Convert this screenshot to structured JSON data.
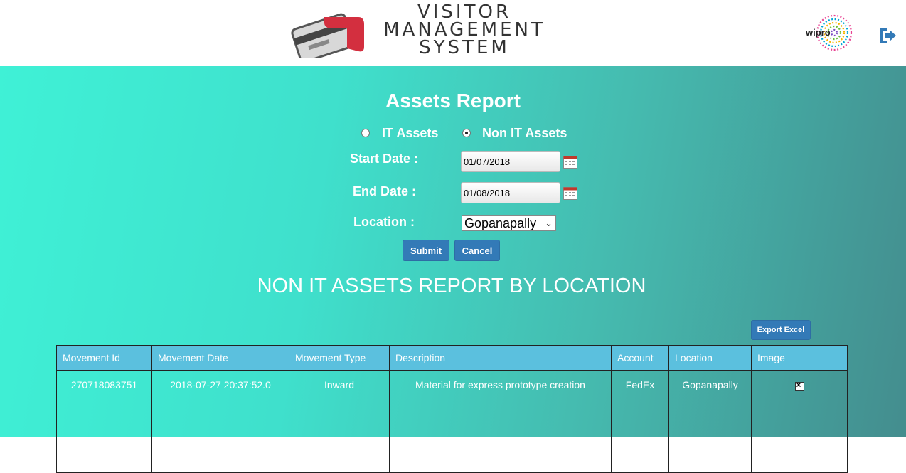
{
  "header": {
    "app_title_lines": [
      "VISITOR",
      "MANAGEMENT",
      "SYSTEM"
    ],
    "brand": "wipro",
    "icons": [
      "card-logo-icon",
      "wipro-logo-icon",
      "logout-icon"
    ]
  },
  "form": {
    "title": "Assets Report",
    "radios": [
      {
        "label": "IT Assets",
        "selected": false
      },
      {
        "label": "Non IT Assets",
        "selected": true
      }
    ],
    "start_date_label": "Start Date :",
    "start_date_value": "01/07/2018",
    "end_date_label": "End Date :",
    "end_date_value": "01/08/2018",
    "location_label": "Location :",
    "location_value": "Gopanapally",
    "submit_label": "Submit",
    "cancel_label": "Cancel"
  },
  "report": {
    "heading": "NON IT ASSETS REPORT BY LOCATION",
    "export_label": "Export Excel",
    "columns": [
      "Movement Id",
      "Movement Date",
      "Movement Type",
      "Description",
      "Account",
      "Location",
      "Image"
    ],
    "rows": [
      [
        "270718083751",
        "2018-07-27 20:37:52.0",
        "Inward",
        "Material for express prototype creation",
        "FedEx",
        "Gopanapally",
        ""
      ]
    ]
  },
  "colors": {
    "accent": "#337ab7",
    "table_header": "#5bc0de",
    "gradient_start": "#3ff1d6",
    "gradient_end": "#448d8e"
  }
}
